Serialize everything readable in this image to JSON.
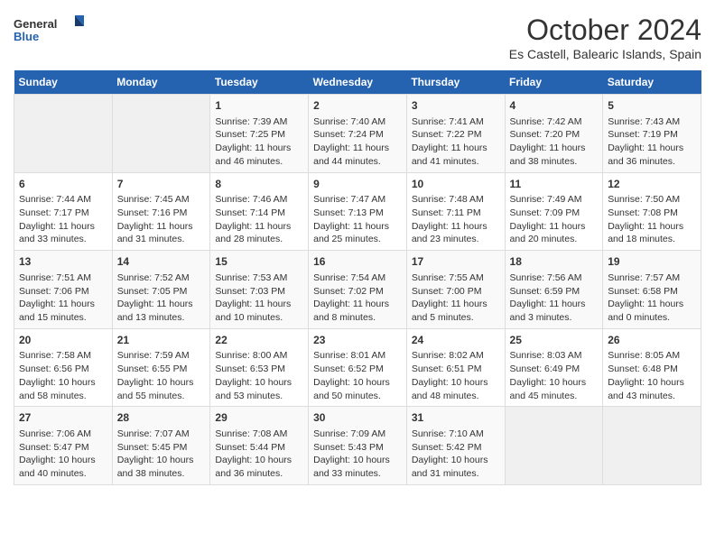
{
  "header": {
    "logo_general": "General",
    "logo_blue": "Blue",
    "month": "October 2024",
    "location": "Es Castell, Balearic Islands, Spain"
  },
  "days_of_week": [
    "Sunday",
    "Monday",
    "Tuesday",
    "Wednesday",
    "Thursday",
    "Friday",
    "Saturday"
  ],
  "weeks": [
    [
      {
        "day": "",
        "content": ""
      },
      {
        "day": "",
        "content": ""
      },
      {
        "day": "1",
        "content": "Sunrise: 7:39 AM\nSunset: 7:25 PM\nDaylight: 11 hours and 46 minutes."
      },
      {
        "day": "2",
        "content": "Sunrise: 7:40 AM\nSunset: 7:24 PM\nDaylight: 11 hours and 44 minutes."
      },
      {
        "day": "3",
        "content": "Sunrise: 7:41 AM\nSunset: 7:22 PM\nDaylight: 11 hours and 41 minutes."
      },
      {
        "day": "4",
        "content": "Sunrise: 7:42 AM\nSunset: 7:20 PM\nDaylight: 11 hours and 38 minutes."
      },
      {
        "day": "5",
        "content": "Sunrise: 7:43 AM\nSunset: 7:19 PM\nDaylight: 11 hours and 36 minutes."
      }
    ],
    [
      {
        "day": "6",
        "content": "Sunrise: 7:44 AM\nSunset: 7:17 PM\nDaylight: 11 hours and 33 minutes."
      },
      {
        "day": "7",
        "content": "Sunrise: 7:45 AM\nSunset: 7:16 PM\nDaylight: 11 hours and 31 minutes."
      },
      {
        "day": "8",
        "content": "Sunrise: 7:46 AM\nSunset: 7:14 PM\nDaylight: 11 hours and 28 minutes."
      },
      {
        "day": "9",
        "content": "Sunrise: 7:47 AM\nSunset: 7:13 PM\nDaylight: 11 hours and 25 minutes."
      },
      {
        "day": "10",
        "content": "Sunrise: 7:48 AM\nSunset: 7:11 PM\nDaylight: 11 hours and 23 minutes."
      },
      {
        "day": "11",
        "content": "Sunrise: 7:49 AM\nSunset: 7:09 PM\nDaylight: 11 hours and 20 minutes."
      },
      {
        "day": "12",
        "content": "Sunrise: 7:50 AM\nSunset: 7:08 PM\nDaylight: 11 hours and 18 minutes."
      }
    ],
    [
      {
        "day": "13",
        "content": "Sunrise: 7:51 AM\nSunset: 7:06 PM\nDaylight: 11 hours and 15 minutes."
      },
      {
        "day": "14",
        "content": "Sunrise: 7:52 AM\nSunset: 7:05 PM\nDaylight: 11 hours and 13 minutes."
      },
      {
        "day": "15",
        "content": "Sunrise: 7:53 AM\nSunset: 7:03 PM\nDaylight: 11 hours and 10 minutes."
      },
      {
        "day": "16",
        "content": "Sunrise: 7:54 AM\nSunset: 7:02 PM\nDaylight: 11 hours and 8 minutes."
      },
      {
        "day": "17",
        "content": "Sunrise: 7:55 AM\nSunset: 7:00 PM\nDaylight: 11 hours and 5 minutes."
      },
      {
        "day": "18",
        "content": "Sunrise: 7:56 AM\nSunset: 6:59 PM\nDaylight: 11 hours and 3 minutes."
      },
      {
        "day": "19",
        "content": "Sunrise: 7:57 AM\nSunset: 6:58 PM\nDaylight: 11 hours and 0 minutes."
      }
    ],
    [
      {
        "day": "20",
        "content": "Sunrise: 7:58 AM\nSunset: 6:56 PM\nDaylight: 10 hours and 58 minutes."
      },
      {
        "day": "21",
        "content": "Sunrise: 7:59 AM\nSunset: 6:55 PM\nDaylight: 10 hours and 55 minutes."
      },
      {
        "day": "22",
        "content": "Sunrise: 8:00 AM\nSunset: 6:53 PM\nDaylight: 10 hours and 53 minutes."
      },
      {
        "day": "23",
        "content": "Sunrise: 8:01 AM\nSunset: 6:52 PM\nDaylight: 10 hours and 50 minutes."
      },
      {
        "day": "24",
        "content": "Sunrise: 8:02 AM\nSunset: 6:51 PM\nDaylight: 10 hours and 48 minutes."
      },
      {
        "day": "25",
        "content": "Sunrise: 8:03 AM\nSunset: 6:49 PM\nDaylight: 10 hours and 45 minutes."
      },
      {
        "day": "26",
        "content": "Sunrise: 8:05 AM\nSunset: 6:48 PM\nDaylight: 10 hours and 43 minutes."
      }
    ],
    [
      {
        "day": "27",
        "content": "Sunrise: 7:06 AM\nSunset: 5:47 PM\nDaylight: 10 hours and 40 minutes."
      },
      {
        "day": "28",
        "content": "Sunrise: 7:07 AM\nSunset: 5:45 PM\nDaylight: 10 hours and 38 minutes."
      },
      {
        "day": "29",
        "content": "Sunrise: 7:08 AM\nSunset: 5:44 PM\nDaylight: 10 hours and 36 minutes."
      },
      {
        "day": "30",
        "content": "Sunrise: 7:09 AM\nSunset: 5:43 PM\nDaylight: 10 hours and 33 minutes."
      },
      {
        "day": "31",
        "content": "Sunrise: 7:10 AM\nSunset: 5:42 PM\nDaylight: 10 hours and 31 minutes."
      },
      {
        "day": "",
        "content": ""
      },
      {
        "day": "",
        "content": ""
      }
    ]
  ]
}
